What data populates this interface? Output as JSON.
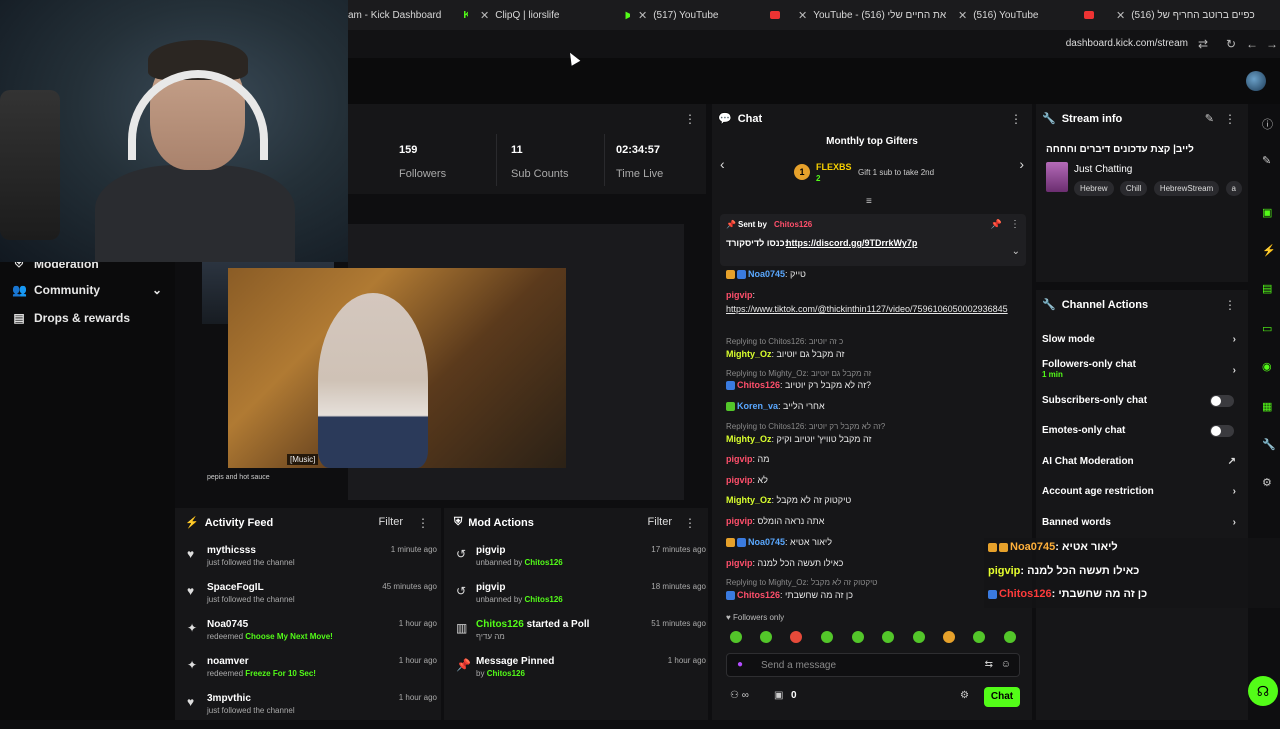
{
  "tabs": [
    {
      "label": "am - Kick Dashboard"
    },
    {
      "label": "ClipQ | liorslife"
    },
    {
      "label": "(517) YouTube"
    },
    {
      "label": "YouTube - את החיים שלי (516)"
    },
    {
      "label": "(516) YouTube"
    },
    {
      "label": "(516) כפיים ברוטב החריף של"
    }
  ],
  "url": "dashboard.kick.com/stream",
  "sidebar": {
    "items": [
      {
        "label": "Moderation",
        "icon": "shield-icon"
      },
      {
        "label": "Community",
        "icon": "community-icon"
      },
      {
        "label": "Drops & rewards",
        "icon": "gift-icon"
      }
    ]
  },
  "stats": {
    "followers_value": "159",
    "followers_label": "Followers",
    "subs_value": "11",
    "subs_label": "Sub Counts",
    "time_value": "02:34:57",
    "time_label": "Time Live"
  },
  "preview": {
    "caption": "[Music]",
    "title": "pepis and hot sauce"
  },
  "activity": {
    "title": "Activity Feed",
    "filter": "Filter",
    "items": [
      {
        "name": "mythicsss",
        "sub": "just followed the channel",
        "time": "1 minute ago",
        "icon": "heart-icon"
      },
      {
        "name": "SpaceFogIL",
        "sub": "just followed the channel",
        "time": "45 minutes ago",
        "icon": "heart-icon"
      },
      {
        "name": "Noa0745",
        "sub_prefix": "redeemed",
        "sub_reward": "Choose My Next Move!",
        "time": "1 hour ago",
        "icon": "reward-icon"
      },
      {
        "name": "noamver",
        "sub_prefix": "redeemed",
        "sub_reward": "Freeze For 10 Sec!",
        "time": "1 hour ago",
        "icon": "reward-icon"
      },
      {
        "name": "3mpvthic",
        "sub": "just followed the channel",
        "time": "1 hour ago",
        "icon": "heart-icon"
      }
    ]
  },
  "modactions": {
    "title": "Mod Actions",
    "filter": "Filter",
    "items": [
      {
        "name": "pigvip",
        "sub_prefix": "unbanned by",
        "by": "Chitos126",
        "time": "17 minutes ago",
        "icon": "undo-icon"
      },
      {
        "name": "pigvip",
        "sub_prefix": "unbanned by",
        "by": "Chitos126",
        "time": "18 minutes ago",
        "icon": "undo-icon"
      },
      {
        "name": "Chitos126",
        "name_suffix": "started a Poll",
        "sub": "מה עדיף",
        "time": "51 minutes ago",
        "icon": "poll-icon"
      },
      {
        "name": "Message Pinned",
        "sub_prefix": "by",
        "by": "Chitos126",
        "time": "1 hour ago",
        "icon": "pin-icon"
      }
    ]
  },
  "chat": {
    "title": "Chat",
    "gifters_title": "Monthly top Gifters",
    "gifter_rank": "1",
    "gifter_name": "FLEXBS",
    "gifter_count": "2",
    "gifter_note": "Gift 1 sub to take 2nd",
    "pinned_by_label": "Sent by",
    "pinned_by": "Chitos126",
    "pinned_text": "כנסו לדיסקורד:",
    "pinned_link": "https://discord.gg/9TDrrkWy7p",
    "messages": [
      {
        "type": "msg",
        "user": "Noa0745",
        "text": "טייק",
        "color": "blue-badge"
      },
      {
        "type": "msg",
        "user": "pigvip",
        "text": ""
      },
      {
        "type": "link",
        "text": "https://www.tiktok.com/@thickinthin1127/video/7596106050002936845"
      },
      {
        "type": "reply",
        "text": "Replying to Chitos126: כ זה יוטיוב"
      },
      {
        "type": "msg",
        "user": "Mighty_Oz",
        "text": "זה מקבל גם יוטיוב"
      },
      {
        "type": "reply",
        "text": "Replying to Mighty_Oz: זה מקבל גם יוטיוב"
      },
      {
        "type": "msg",
        "user": "Chitos126",
        "text": "זה לא מקבל רק יוטיוב?"
      },
      {
        "type": "msg",
        "user": "Koren_va",
        "text": "אחרי הלייב"
      },
      {
        "type": "reply",
        "text": "Replying to Chitos126: זה לא מקבל רק יוטיוב?"
      },
      {
        "type": "msg",
        "user": "Mighty_Oz",
        "text": "זה מקבל טוויץ' יוטיוב וקיק"
      },
      {
        "type": "msg",
        "user": "pigvip",
        "text": "מה"
      },
      {
        "type": "msg",
        "user": "pigvip",
        "text": "לא"
      },
      {
        "type": "msg",
        "user": "Mighty_Oz",
        "text": "טיקטוק זה לא מקבל"
      },
      {
        "type": "msg",
        "user": "pigvip",
        "text": "אתה נראה הומלס"
      },
      {
        "type": "msg",
        "user": "Noa0745",
        "text": "ליאור אטיא"
      },
      {
        "type": "msg",
        "user": "pigvip",
        "text": "כאילו תעשה הכל למנה"
      },
      {
        "type": "reply",
        "text": "Replying to Mighty_Oz: טיקטוק זה לא מקבל"
      },
      {
        "type": "msg",
        "user": "Chitos126",
        "text": "כן זה מה שחשבתי"
      }
    ],
    "followers_only": "Followers only",
    "input_placeholder": "Send a message",
    "count": "0",
    "chat_button": "Chat"
  },
  "streaminfo": {
    "title": "Stream info",
    "stream_title": "לייב| קצת עדכונים דיברים וחחחה",
    "category": "Just Chatting",
    "tags": [
      "Hebrew",
      "Chill",
      "HebrewStream",
      "a"
    ]
  },
  "actions": {
    "title": "Channel Actions",
    "items": [
      {
        "label": "Slow mode",
        "control": "chevron"
      },
      {
        "label": "Followers-only chat",
        "sub": "1 min",
        "control": "chevron"
      },
      {
        "label": "Subscribers-only chat",
        "control": "toggle"
      },
      {
        "label": "Emotes-only chat",
        "control": "toggle"
      },
      {
        "label": "AI Chat Moderation",
        "control": "external"
      },
      {
        "label": "Account age restriction",
        "control": "chevron"
      },
      {
        "label": "Banned words",
        "control": "chevron"
      }
    ]
  },
  "overlay": {
    "lines": [
      {
        "user": "Noa0745",
        "text": "ליאור אטיא"
      },
      {
        "user": "pigvip",
        "text": "כאילו תעשה הכל למנה"
      },
      {
        "user": "Chitos126",
        "text": "כן זה מה שחשבתי"
      }
    ]
  }
}
